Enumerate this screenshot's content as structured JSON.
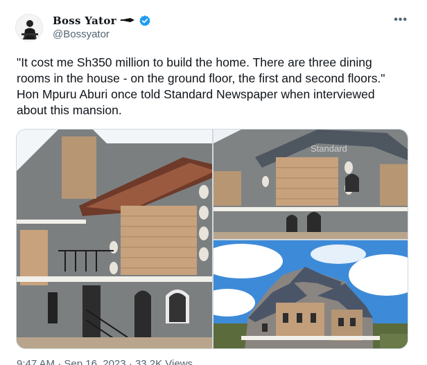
{
  "author": {
    "display_name": "Boss Yator",
    "handle": "@Bossyator",
    "name_suffix_icon": "pencil-icon",
    "verified_icon": "verified-badge-icon"
  },
  "menu": {
    "more_label": "•••"
  },
  "tweet": {
    "text_lines": [
      "\"It cost me Sh350 million to build the home. There are three dining",
      "rooms in the house - on the ground floor, the first and second floors.\"",
      "Hon Mpuru Aburi once told Standard Newspaper when interviewed",
      "about this mansion."
    ]
  },
  "media": {
    "photos": [
      {
        "description_icon": "house-photo",
        "watermark": ""
      },
      {
        "description_icon": "house-photo",
        "watermark": "Standard"
      },
      {
        "description_icon": "house-photo",
        "watermark": ""
      }
    ]
  },
  "footer": {
    "timestamp": "9:47 AM · Sep 16, 2023 · 33.2K Views"
  },
  "colors": {
    "accent": "#1d9bf0",
    "muted": "#536471",
    "text": "#0f1419"
  }
}
